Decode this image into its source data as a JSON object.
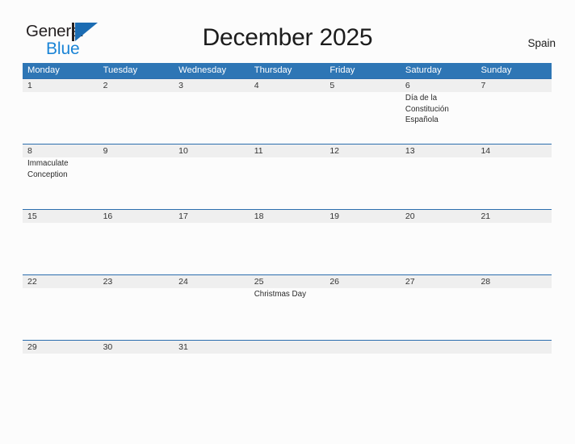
{
  "brand": {
    "name_part1": "General",
    "name_part2": "Blue",
    "mark_icon": "triangle-flag-icon",
    "accent_color": "#1a84d6",
    "mark_color": "#1b6cb3"
  },
  "header": {
    "title": "December 2025",
    "country": "Spain"
  },
  "colors": {
    "header_blue": "#2e76b5",
    "row_rule": "#2c6eae",
    "band_gray": "#efefef",
    "page_background": "#fcfcfc",
    "text": "#333333"
  },
  "calendar": {
    "weekdays": [
      "Monday",
      "Tuesday",
      "Wednesday",
      "Thursday",
      "Friday",
      "Saturday",
      "Sunday"
    ],
    "weeks": [
      {
        "days": [
          {
            "num": "1",
            "event": ""
          },
          {
            "num": "2",
            "event": ""
          },
          {
            "num": "3",
            "event": ""
          },
          {
            "num": "4",
            "event": ""
          },
          {
            "num": "5",
            "event": ""
          },
          {
            "num": "6",
            "event": "Día de la Constitución Española"
          },
          {
            "num": "7",
            "event": ""
          }
        ]
      },
      {
        "days": [
          {
            "num": "8",
            "event": "Immaculate Conception"
          },
          {
            "num": "9",
            "event": ""
          },
          {
            "num": "10",
            "event": ""
          },
          {
            "num": "11",
            "event": ""
          },
          {
            "num": "12",
            "event": ""
          },
          {
            "num": "13",
            "event": ""
          },
          {
            "num": "14",
            "event": ""
          }
        ]
      },
      {
        "days": [
          {
            "num": "15",
            "event": ""
          },
          {
            "num": "16",
            "event": ""
          },
          {
            "num": "17",
            "event": ""
          },
          {
            "num": "18",
            "event": ""
          },
          {
            "num": "19",
            "event": ""
          },
          {
            "num": "20",
            "event": ""
          },
          {
            "num": "21",
            "event": ""
          }
        ]
      },
      {
        "days": [
          {
            "num": "22",
            "event": ""
          },
          {
            "num": "23",
            "event": ""
          },
          {
            "num": "24",
            "event": ""
          },
          {
            "num": "25",
            "event": "Christmas Day"
          },
          {
            "num": "26",
            "event": ""
          },
          {
            "num": "27",
            "event": ""
          },
          {
            "num": "28",
            "event": ""
          }
        ]
      },
      {
        "days": [
          {
            "num": "29",
            "event": ""
          },
          {
            "num": "30",
            "event": ""
          },
          {
            "num": "31",
            "event": ""
          },
          {
            "num": "",
            "event": ""
          },
          {
            "num": "",
            "event": ""
          },
          {
            "num": "",
            "event": ""
          },
          {
            "num": "",
            "event": ""
          }
        ]
      }
    ]
  }
}
